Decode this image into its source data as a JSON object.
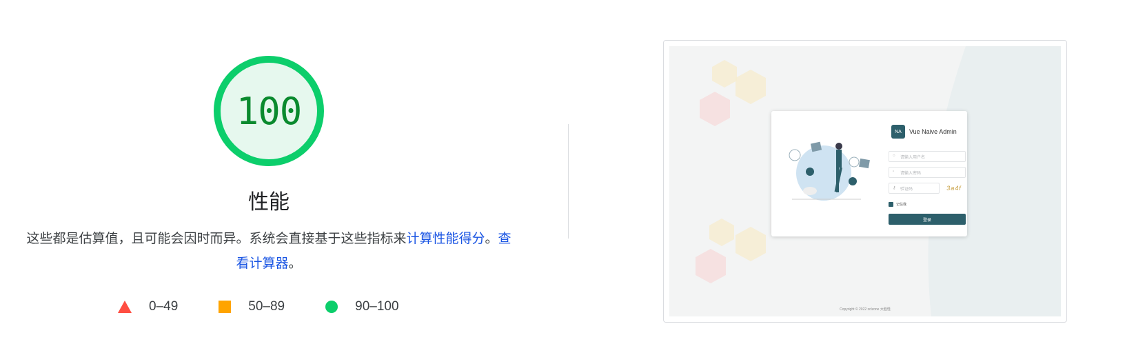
{
  "score": {
    "value": "100",
    "fraction": 1.0,
    "title": "性能",
    "colors": {
      "ring": "#0cce6b",
      "fill": "#e6f8ee",
      "text": "#0a8a2e"
    }
  },
  "description": {
    "text_before": "这些都是估算值，且可能会因时而异。系统会直接基于这些指标来",
    "link_calc_score": "计算性能得分",
    "separator": "。",
    "link_calculator": "查看计算器",
    "end": "。",
    "link_color": "#1a55e3"
  },
  "legend": [
    {
      "icon": "triangle-icon",
      "range": "0–49",
      "color": "#ff4e42"
    },
    {
      "icon": "square-icon",
      "range": "50–89",
      "color": "#ffa400"
    },
    {
      "icon": "circle-icon",
      "range": "90–100",
      "color": "#0cce6b"
    }
  ],
  "screenshot": {
    "app_name": "Vue Naive Admin",
    "logo_text": "NA",
    "username_placeholder": "请输入用户名",
    "password_placeholder": "请输入密码",
    "captcha_placeholder": "验证码",
    "captcha_text": "3a4f",
    "remember_label": "记住我",
    "login_button": "登录",
    "copyright": "Copyright © 2022 zclzone 大脸怪",
    "accent": "#2d5f6b"
  }
}
